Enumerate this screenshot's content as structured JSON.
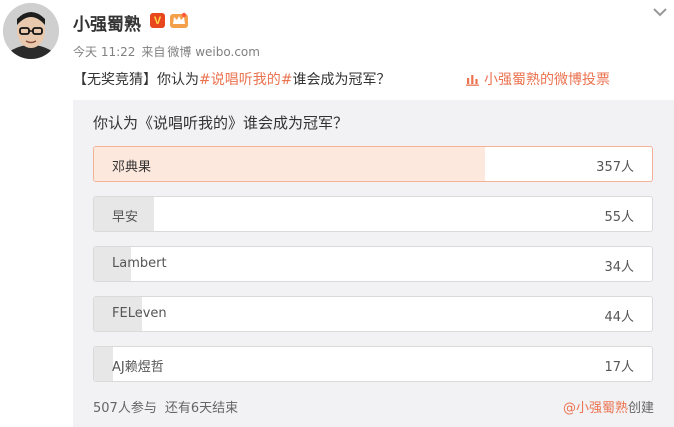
{
  "post": {
    "username": "小强蜀熟",
    "verified_badge": "V",
    "icons": {
      "verified": "verified-v-icon",
      "member": "member-crown-icon",
      "collapse": "chevron-down-icon",
      "vote": "bar-chart-icon",
      "avatar": "avatar-photo"
    },
    "meta": {
      "time": "今天 11:22",
      "source_prefix": "来自",
      "source": "微博 weibo.com"
    },
    "text": {
      "tag": "【无奖竞猜】",
      "before": "你认为",
      "topic": "#说唱听我的#",
      "after": "谁会成为冠军？"
    },
    "vote_link": "小强蜀熟的微博投票"
  },
  "poll": {
    "question": "你认为《说唱听我的》谁会成为冠军？",
    "options": [
      {
        "label": "邓典果",
        "count": "357人",
        "votes": 357,
        "selected": true
      },
      {
        "label": "早安",
        "count": "55人",
        "votes": 55,
        "selected": false
      },
      {
        "label": "Lambert",
        "count": "34人",
        "votes": 34,
        "selected": false
      },
      {
        "label": "FELeven",
        "count": "44人",
        "votes": 44,
        "selected": false
      },
      {
        "label": "AJ赖煜哲",
        "count": "17人",
        "votes": 17,
        "selected": false
      }
    ],
    "participants": "507人参与",
    "remaining": "还有6天结束",
    "creator": "@小强蜀熟",
    "creator_suffix": "创建"
  },
  "colors": {
    "accent": "#eb7350",
    "selected_fill": "#fde8de",
    "bar_fill": "#e7e7e7",
    "panel_bg": "#f2f2f5"
  }
}
